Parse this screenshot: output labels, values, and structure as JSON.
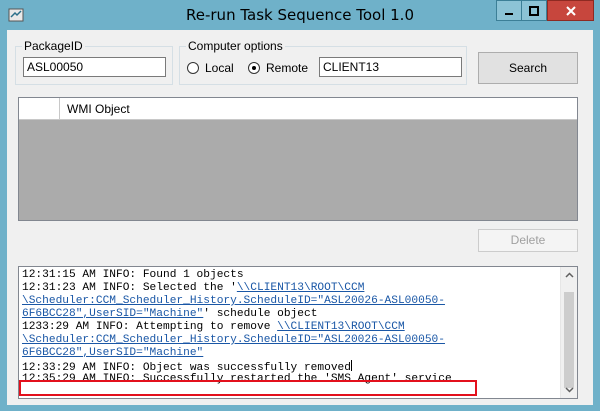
{
  "window": {
    "title": "Re-run Task Sequence Tool 1.0",
    "colors": {
      "frame": "#6fb1c9",
      "close": "#c7463d",
      "highlight": "#e3101c",
      "link": "#1a57a6"
    }
  },
  "package": {
    "legend": "PackageID",
    "value": "ASL00050"
  },
  "computer": {
    "legend": "Computer options",
    "local_label": "Local",
    "remote_label": "Remote",
    "selected": "Remote",
    "name_value": "CLIENT13"
  },
  "buttons": {
    "search": "Search",
    "delete": "Delete"
  },
  "grid": {
    "columns": [
      "WMI Object"
    ]
  },
  "log": {
    "lines": [
      [
        {
          "t": "12:31:15 AM INFO: Found 1 objects"
        }
      ],
      [
        {
          "t": "12:31:23 AM INFO: Selected the '"
        },
        {
          "t": "\\\\CLIENT13\\ROOT\\CCM",
          "link": true
        }
      ],
      [
        {
          "t": "\\Scheduler:CCM_Scheduler_History.ScheduleID=\"ASL20026-ASL00050-",
          "link": true
        }
      ],
      [
        {
          "t": "6F6BCC28\",UserSID=\"Machine\"",
          "link": true
        },
        {
          "t": "' schedule object"
        }
      ],
      [
        {
          "t": "1233:29 AM INFO: Attempting to remove "
        },
        {
          "t": "\\\\CLIENT13\\ROOT\\CCM",
          "link": true
        }
      ],
      [
        {
          "t": "\\Scheduler:CCM_Scheduler_History.ScheduleID=\"ASL20026-ASL00050-",
          "link": true
        }
      ],
      [
        {
          "t": "6F6BCC28\",UserSID=\"Machine\"",
          "link": true
        }
      ],
      [
        {
          "t": "12:33:29 AM INFO: Object was successfully removed"
        }
      ],
      [
        {
          "t": "12:35:29 AM INFO: Successfully restarted the 'SMS Agent' service"
        }
      ]
    ]
  }
}
